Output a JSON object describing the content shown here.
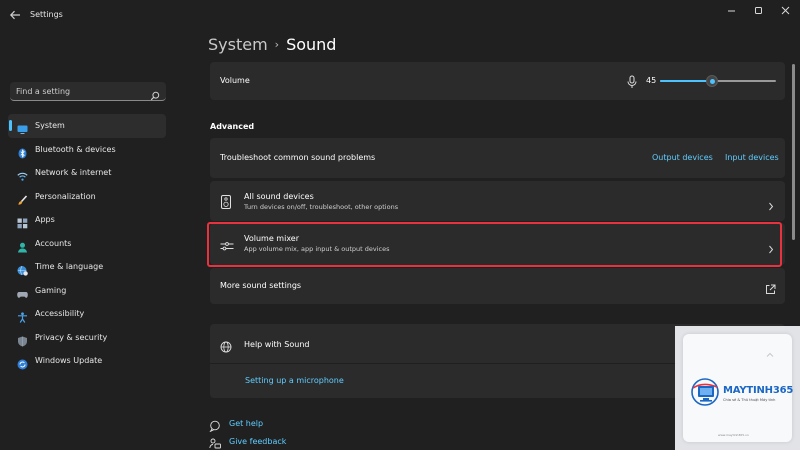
{
  "window": {
    "title": "Settings",
    "controls": [
      "minimize-icon",
      "maximize-icon",
      "close-icon"
    ]
  },
  "sidebar": {
    "search_placeholder": "Find a setting",
    "items": [
      {
        "label": "System",
        "icon": "monitor-icon",
        "active": true
      },
      {
        "label": "Bluetooth & devices",
        "icon": "bluetooth-icon"
      },
      {
        "label": "Network & internet",
        "icon": "wifi-icon"
      },
      {
        "label": "Personalization",
        "icon": "brush-icon"
      },
      {
        "label": "Apps",
        "icon": "apps-icon"
      },
      {
        "label": "Accounts",
        "icon": "person-icon"
      },
      {
        "label": "Time & language",
        "icon": "globe-clock-icon"
      },
      {
        "label": "Gaming",
        "icon": "gamepad-icon"
      },
      {
        "label": "Accessibility",
        "icon": "accessibility-icon"
      },
      {
        "label": "Privacy & security",
        "icon": "shield-icon"
      },
      {
        "label": "Windows Update",
        "icon": "update-icon"
      }
    ]
  },
  "breadcrumb": {
    "parent": "System",
    "separator": "›",
    "current": "Sound"
  },
  "volume": {
    "label": "Volume",
    "value": "45",
    "level": 0.45,
    "icon": "microphone-icon"
  },
  "advanced": {
    "heading": "Advanced",
    "troubleshoot": {
      "label": "Troubleshoot common sound problems",
      "link1": "Output devices",
      "link2": "Input devices"
    },
    "all_devices": {
      "title": "All sound devices",
      "subtitle": "Turn devices on/off, troubleshoot, other options",
      "icon": "speaker-device-icon"
    },
    "mixer": {
      "title": "Volume mixer",
      "subtitle": "App volume mix, app input & output devices",
      "icon": "mixer-icon"
    },
    "more": {
      "label": "More sound settings",
      "icon": "open-external-icon"
    }
  },
  "help": {
    "title": "Help with Sound",
    "link": "Setting up a microphone",
    "icon": "globe-icon"
  },
  "footer": {
    "get_help": "Get help",
    "give_feedback": "Give feedback"
  },
  "watermark": {
    "brand": "MAYTINH365",
    "tagline": "Chia sẻ & Thủ thuật Máy tính",
    "url": "www.maytinh365.vn"
  },
  "colors": {
    "background": "#202020",
    "card": "#2b2b2b",
    "accent": "#4cc2ff",
    "link": "#60cdff",
    "highlight": "#e8323f"
  }
}
